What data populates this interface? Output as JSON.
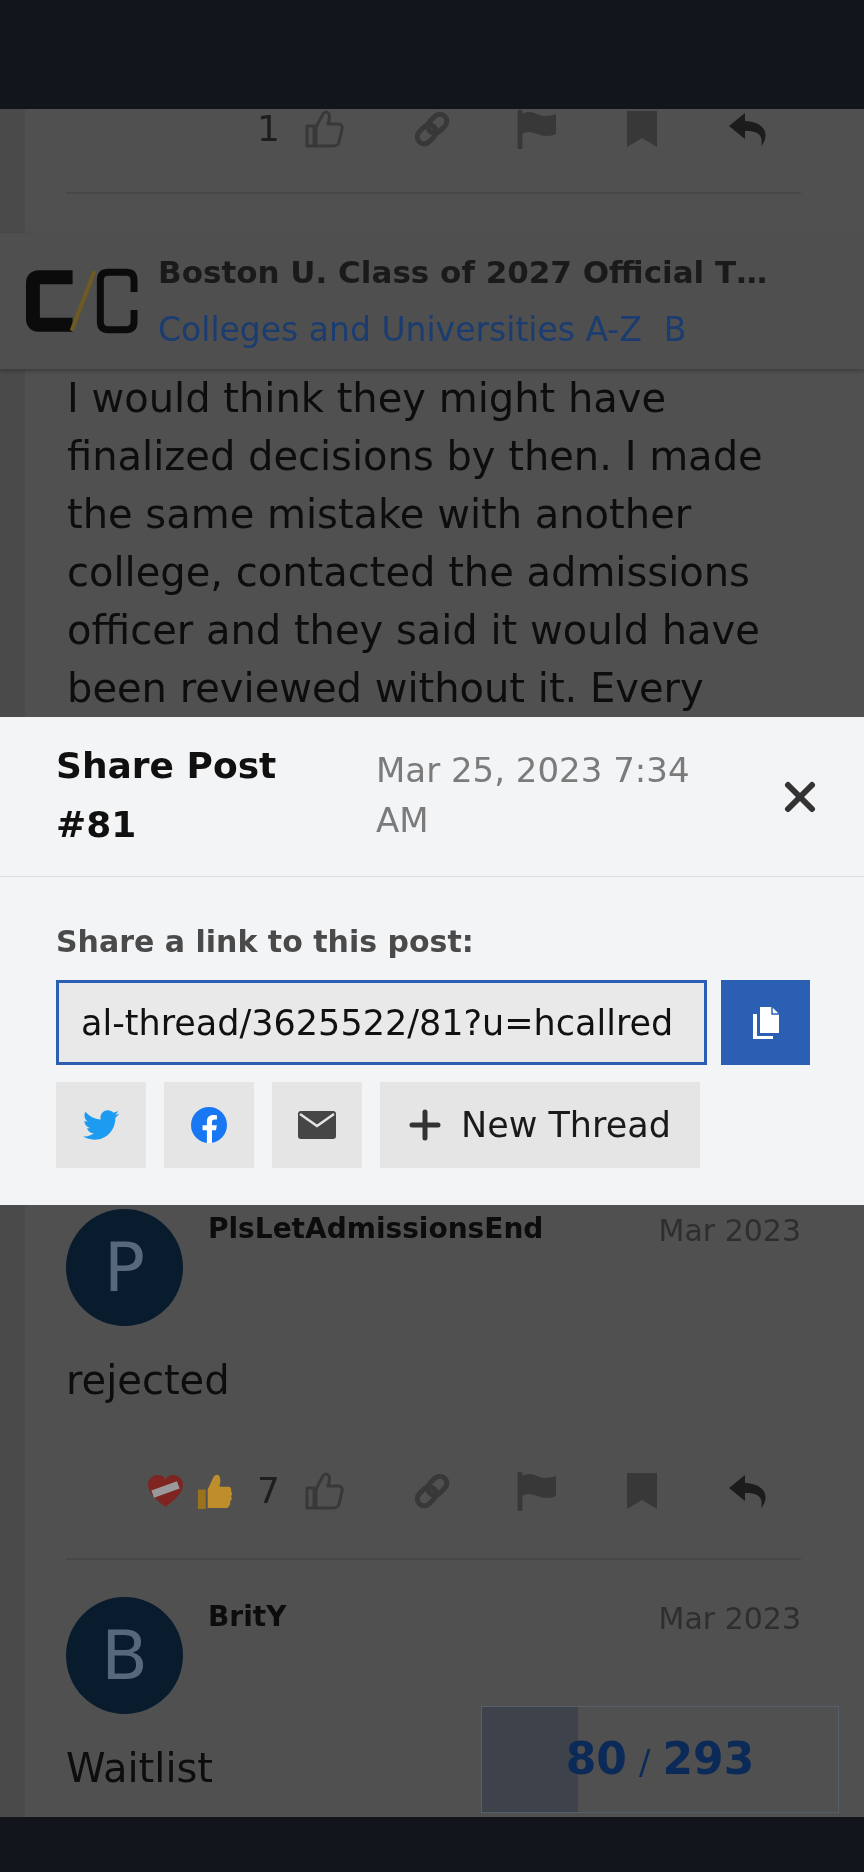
{
  "previous_post": {
    "like_count": "1"
  },
  "topic_header": {
    "title": "Boston U. Class of 2027 Official T…",
    "breadcrumbs": [
      "Colleges and Universities A-Z",
      "B"
    ]
  },
  "post_excerpt": {
    "body": "I would think they might have finalized decisions by then. I made the same mistake with another college, contacted the admissions officer and they said it would have been reviewed without it. Every"
  },
  "share_dialog": {
    "title": "Share Post #81",
    "timestamp": "Mar 25, 2023 7:34 AM",
    "label": "Share a link to this post:",
    "link": "al-thread/3625522/81?u=hcallred",
    "share_buttons": [
      {
        "kind": "twitter"
      },
      {
        "kind": "facebook"
      },
      {
        "kind": "email"
      },
      {
        "kind": "new_thread",
        "label": "New Thread"
      }
    ]
  },
  "posts": [
    {
      "author": "PlsLetAdmissionsEnd",
      "avatar_letter": "P",
      "date": "Mar 2023",
      "body": "rejected",
      "reactions": [
        {
          "kind": "mending_heart"
        },
        {
          "kind": "thumbs_up"
        }
      ],
      "like_count": "7"
    },
    {
      "author": "BritY",
      "avatar_letter": "B",
      "date": "Mar 2023",
      "body": "Waitlist"
    }
  ],
  "progress": {
    "current": "80",
    "separator": "/",
    "total": "293",
    "level": 0.27
  }
}
